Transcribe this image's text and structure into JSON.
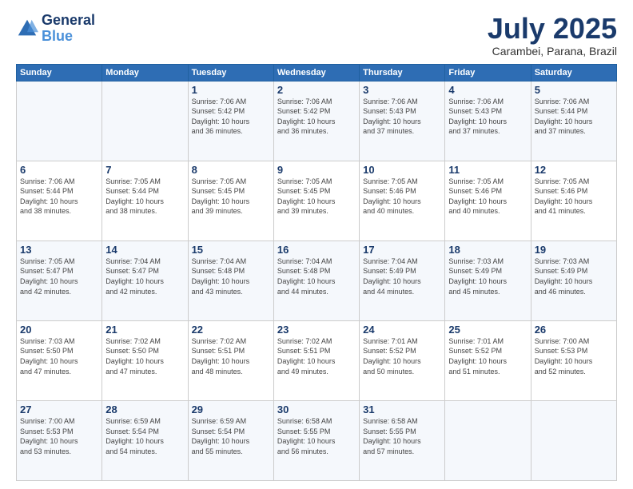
{
  "logo": {
    "line1": "General",
    "line2": "Blue"
  },
  "header": {
    "month": "July 2025",
    "location": "Carambei, Parana, Brazil"
  },
  "weekdays": [
    "Sunday",
    "Monday",
    "Tuesday",
    "Wednesday",
    "Thursday",
    "Friday",
    "Saturday"
  ],
  "weeks": [
    [
      {
        "day": "",
        "info": ""
      },
      {
        "day": "",
        "info": ""
      },
      {
        "day": "1",
        "info": "Sunrise: 7:06 AM\nSunset: 5:42 PM\nDaylight: 10 hours\nand 36 minutes."
      },
      {
        "day": "2",
        "info": "Sunrise: 7:06 AM\nSunset: 5:42 PM\nDaylight: 10 hours\nand 36 minutes."
      },
      {
        "day": "3",
        "info": "Sunrise: 7:06 AM\nSunset: 5:43 PM\nDaylight: 10 hours\nand 37 minutes."
      },
      {
        "day": "4",
        "info": "Sunrise: 7:06 AM\nSunset: 5:43 PM\nDaylight: 10 hours\nand 37 minutes."
      },
      {
        "day": "5",
        "info": "Sunrise: 7:06 AM\nSunset: 5:44 PM\nDaylight: 10 hours\nand 37 minutes."
      }
    ],
    [
      {
        "day": "6",
        "info": "Sunrise: 7:06 AM\nSunset: 5:44 PM\nDaylight: 10 hours\nand 38 minutes."
      },
      {
        "day": "7",
        "info": "Sunrise: 7:05 AM\nSunset: 5:44 PM\nDaylight: 10 hours\nand 38 minutes."
      },
      {
        "day": "8",
        "info": "Sunrise: 7:05 AM\nSunset: 5:45 PM\nDaylight: 10 hours\nand 39 minutes."
      },
      {
        "day": "9",
        "info": "Sunrise: 7:05 AM\nSunset: 5:45 PM\nDaylight: 10 hours\nand 39 minutes."
      },
      {
        "day": "10",
        "info": "Sunrise: 7:05 AM\nSunset: 5:46 PM\nDaylight: 10 hours\nand 40 minutes."
      },
      {
        "day": "11",
        "info": "Sunrise: 7:05 AM\nSunset: 5:46 PM\nDaylight: 10 hours\nand 40 minutes."
      },
      {
        "day": "12",
        "info": "Sunrise: 7:05 AM\nSunset: 5:46 PM\nDaylight: 10 hours\nand 41 minutes."
      }
    ],
    [
      {
        "day": "13",
        "info": "Sunrise: 7:05 AM\nSunset: 5:47 PM\nDaylight: 10 hours\nand 42 minutes."
      },
      {
        "day": "14",
        "info": "Sunrise: 7:04 AM\nSunset: 5:47 PM\nDaylight: 10 hours\nand 42 minutes."
      },
      {
        "day": "15",
        "info": "Sunrise: 7:04 AM\nSunset: 5:48 PM\nDaylight: 10 hours\nand 43 minutes."
      },
      {
        "day": "16",
        "info": "Sunrise: 7:04 AM\nSunset: 5:48 PM\nDaylight: 10 hours\nand 44 minutes."
      },
      {
        "day": "17",
        "info": "Sunrise: 7:04 AM\nSunset: 5:49 PM\nDaylight: 10 hours\nand 44 minutes."
      },
      {
        "day": "18",
        "info": "Sunrise: 7:03 AM\nSunset: 5:49 PM\nDaylight: 10 hours\nand 45 minutes."
      },
      {
        "day": "19",
        "info": "Sunrise: 7:03 AM\nSunset: 5:49 PM\nDaylight: 10 hours\nand 46 minutes."
      }
    ],
    [
      {
        "day": "20",
        "info": "Sunrise: 7:03 AM\nSunset: 5:50 PM\nDaylight: 10 hours\nand 47 minutes."
      },
      {
        "day": "21",
        "info": "Sunrise: 7:02 AM\nSunset: 5:50 PM\nDaylight: 10 hours\nand 47 minutes."
      },
      {
        "day": "22",
        "info": "Sunrise: 7:02 AM\nSunset: 5:51 PM\nDaylight: 10 hours\nand 48 minutes."
      },
      {
        "day": "23",
        "info": "Sunrise: 7:02 AM\nSunset: 5:51 PM\nDaylight: 10 hours\nand 49 minutes."
      },
      {
        "day": "24",
        "info": "Sunrise: 7:01 AM\nSunset: 5:52 PM\nDaylight: 10 hours\nand 50 minutes."
      },
      {
        "day": "25",
        "info": "Sunrise: 7:01 AM\nSunset: 5:52 PM\nDaylight: 10 hours\nand 51 minutes."
      },
      {
        "day": "26",
        "info": "Sunrise: 7:00 AM\nSunset: 5:53 PM\nDaylight: 10 hours\nand 52 minutes."
      }
    ],
    [
      {
        "day": "27",
        "info": "Sunrise: 7:00 AM\nSunset: 5:53 PM\nDaylight: 10 hours\nand 53 minutes."
      },
      {
        "day": "28",
        "info": "Sunrise: 6:59 AM\nSunset: 5:54 PM\nDaylight: 10 hours\nand 54 minutes."
      },
      {
        "day": "29",
        "info": "Sunrise: 6:59 AM\nSunset: 5:54 PM\nDaylight: 10 hours\nand 55 minutes."
      },
      {
        "day": "30",
        "info": "Sunrise: 6:58 AM\nSunset: 5:55 PM\nDaylight: 10 hours\nand 56 minutes."
      },
      {
        "day": "31",
        "info": "Sunrise: 6:58 AM\nSunset: 5:55 PM\nDaylight: 10 hours\nand 57 minutes."
      },
      {
        "day": "",
        "info": ""
      },
      {
        "day": "",
        "info": ""
      }
    ]
  ]
}
